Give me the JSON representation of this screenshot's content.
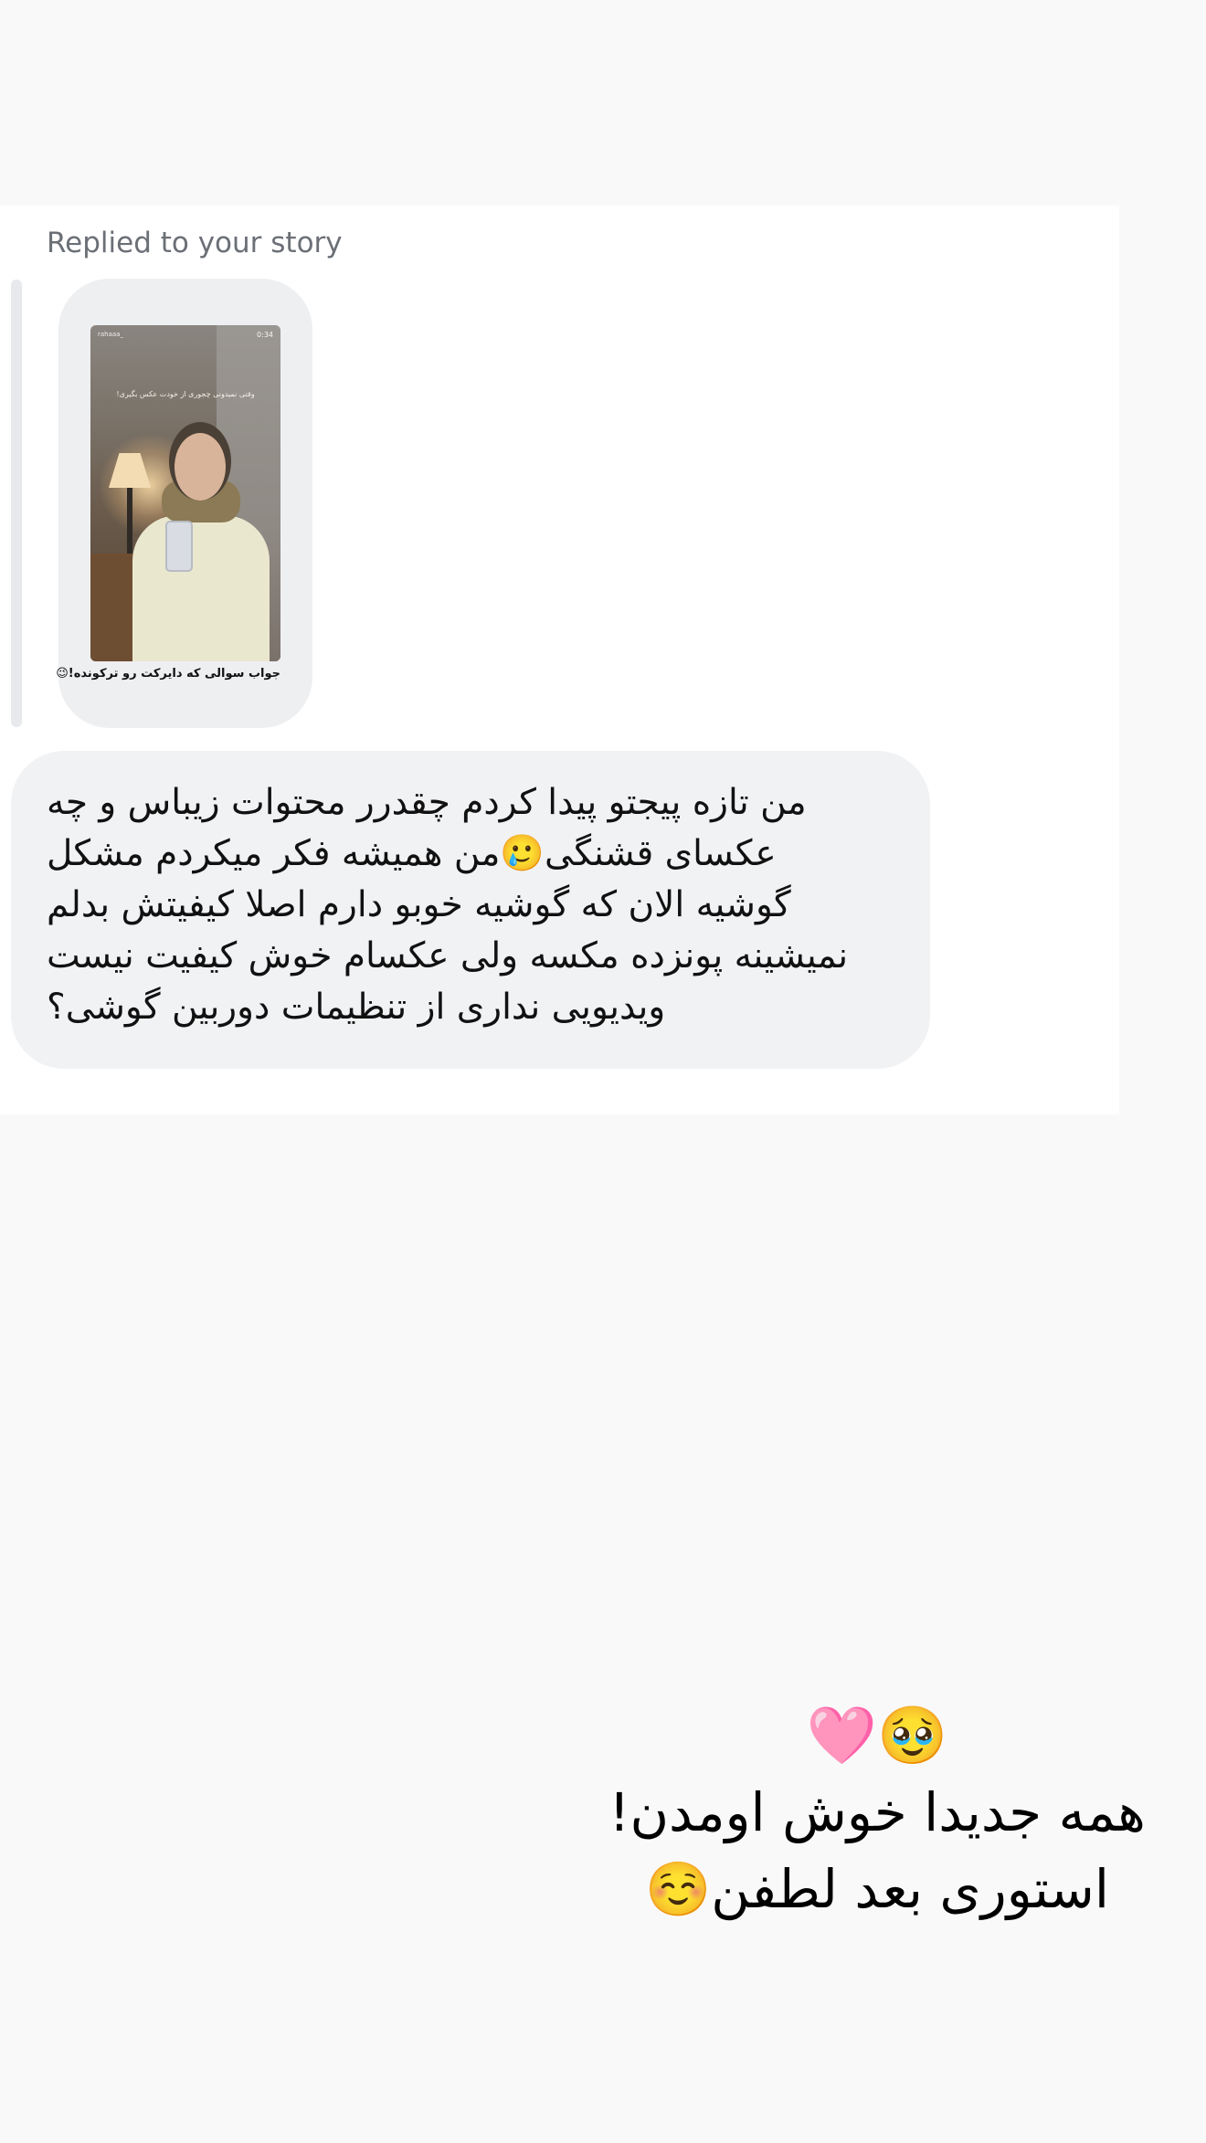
{
  "reply": {
    "label": "Replied to your story"
  },
  "story": {
    "thumb_top_left": "rahaaa_",
    "thumb_top_right": "0:34",
    "thumb_overlay_text": "وقتی نمیدونی چجوری از خودت عکس بگیری!",
    "caption": "جواب سوالی که دایرکت رو ترکونده!😉"
  },
  "message": {
    "lines": [
      "من تازه پیجتو پیدا کردم چقدرر محتوات زیباس و چه",
      "عکسای قشنگی🥲من همیشه فکر میکردم مشکل",
      "گوشیه الان که گوشیه خوبو دارم اصلا کیفیتش بدلم",
      "نمیشینه پونزده مکسه ولی عکسام خوش کیفیت نیست",
      "ویدیویی نداری از تنظیمات دوربین گوشی؟"
    ]
  },
  "story_overlay": {
    "line1": "🥹🩷",
    "line2": "همه جدیدا خوش اومدن!",
    "line3": "استوری بعد لطفن☺️"
  }
}
